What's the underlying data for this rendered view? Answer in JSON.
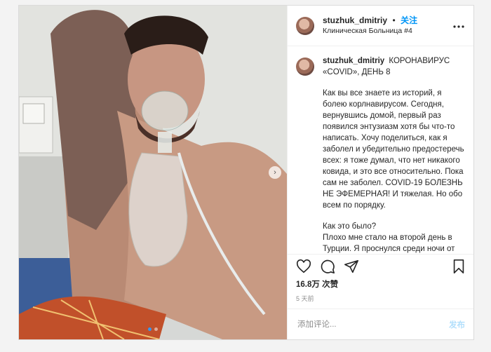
{
  "post": {
    "username": "stuzhuk_dmitriy",
    "follow_separator": "•",
    "follow_label": "关注",
    "location": "Клиническая Больница #4",
    "more_icon": "more-horizontal-icon",
    "caption_title": "КОРОНАВИРУС «COVID», ДЕНЬ 8",
    "caption_paragraphs": [
      "Как вы все знаете из историй, я болею корлнавирусом. Сегодня, вернувшись домой, первый раз появился энтузиазм хотя бы что-то написать. Хочу поделиться, как я заболел и убедительно предостеречь всех: я тоже думал, что нет никакого ковида, и это все относительно. Пока сам не заболел. COVID-19 БОЛЕЗНЬ НЕ ЭФЕМЕРНАЯ! И тяжелая. Но обо всем по порядку.",
      "Как это было?\nПлохо мне стало на второй день в Турции. Я проснулся среди ночи от того, что у меня отекла шея и было"
    ],
    "likes": "16.8万 次赞",
    "time_ago": "5 天前",
    "comment_placeholder": "添加评论...",
    "post_button": "发布",
    "carousel_next": "›"
  },
  "colors": {
    "accent": "#0095f6",
    "post_disabled": "#b2dffc"
  }
}
